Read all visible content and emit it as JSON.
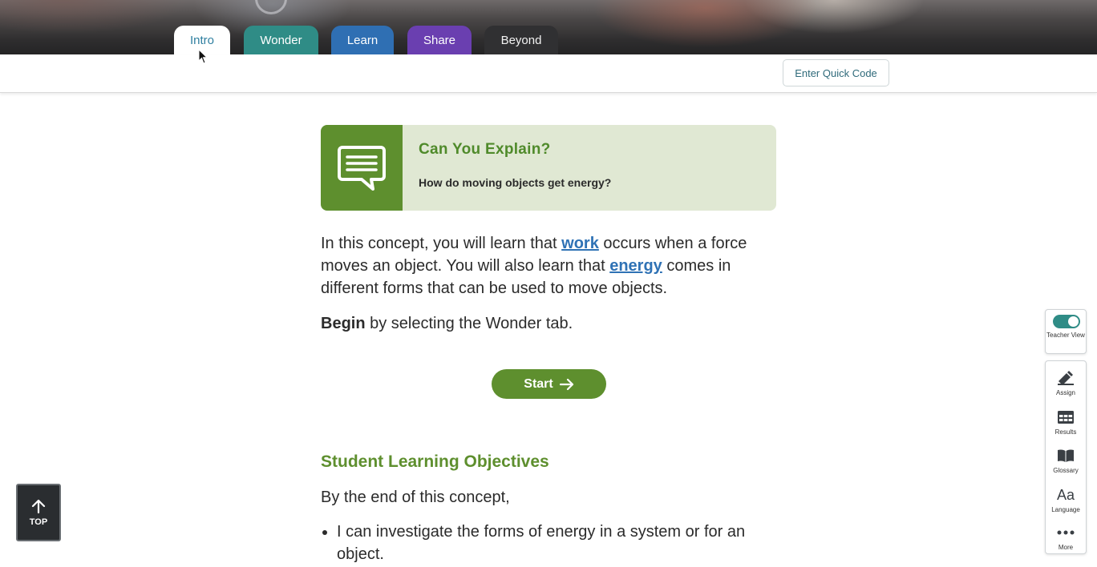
{
  "tabs": [
    {
      "label": "Intro",
      "active": true
    },
    {
      "label": "Wonder"
    },
    {
      "label": "Learn"
    },
    {
      "label": "Share"
    },
    {
      "label": "Beyond"
    }
  ],
  "subheader": {
    "quick_code_label": "Enter Quick Code"
  },
  "explain": {
    "title": "Can You Explain?",
    "question": "How do moving objects get energy?",
    "icon": "speech-bubble-icon"
  },
  "intro": {
    "p1_part1": "In this concept, you will learn that ",
    "link_work": "work",
    "p1_part2": " occurs when a force moves an object. You will also learn that ",
    "link_energy": "energy",
    "p1_part3": " comes in different forms that can be used to move objects.",
    "begin_bold": "Begin",
    "begin_rest": " by selecting the Wonder tab."
  },
  "start_button": {
    "label": "Start",
    "icon": "arrow-right-icon"
  },
  "objectives": {
    "heading": "Student Learning Objectives",
    "intro": "By the end of this concept,",
    "items": [
      "I can investigate the forms of energy in a system or for an object."
    ]
  },
  "top_button": {
    "label": "TOP",
    "icon": "arrow-up-icon"
  },
  "toolbar": {
    "teacher_view": {
      "label": "Teacher View",
      "enabled": true
    },
    "tools": [
      {
        "label": "Assign",
        "icon": "assign-icon"
      },
      {
        "label": "Results",
        "icon": "results-table-icon"
      },
      {
        "label": "Glossary",
        "icon": "book-icon"
      },
      {
        "label": "Language",
        "icon": "language-icon",
        "glyph": "Aa"
      },
      {
        "label": "More",
        "icon": "more-dots-icon"
      }
    ]
  },
  "colors": {
    "wonder": "#2f8c86",
    "learn": "#2f6fb3",
    "share": "#6a3fb0",
    "accent_green": "#5e8f2e",
    "link_blue": "#2f72b5"
  }
}
